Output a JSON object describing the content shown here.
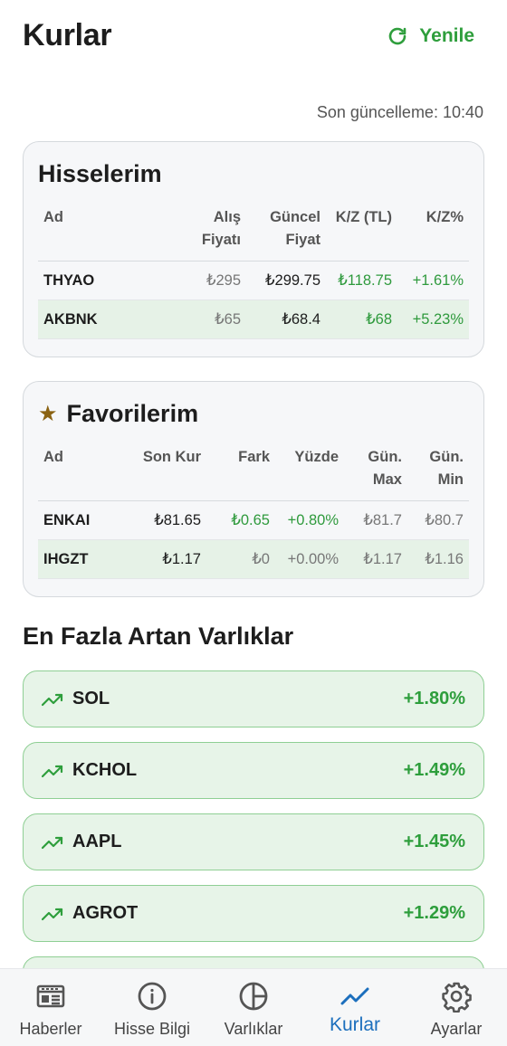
{
  "header": {
    "title": "Kurlar",
    "refresh_label": "Yenile"
  },
  "last_update": "Son güncelleme: 10:40",
  "holdings": {
    "title": "Hisselerim",
    "columns": [
      {
        "line1": "Ad",
        "line2": ""
      },
      {
        "line1": "Alış",
        "line2": "Fiyatı"
      },
      {
        "line1": "Güncel",
        "line2": "Fiyat"
      },
      {
        "line1": "K/Z (TL)",
        "line2": ""
      },
      {
        "line1": "K/Z%",
        "line2": ""
      }
    ],
    "rows": [
      {
        "symbol": "THYAO",
        "buy": "₺295",
        "current": "₺299.75",
        "pl": "₺118.75",
        "pl_pct": "+1.61%"
      },
      {
        "symbol": "AKBNK",
        "buy": "₺65",
        "current": "₺68.4",
        "pl": "₺68",
        "pl_pct": "+5.23%"
      }
    ]
  },
  "favorites": {
    "title": "Favorilerim",
    "columns": [
      {
        "line1": "Ad",
        "line2": ""
      },
      {
        "line1": "Son Kur",
        "line2": ""
      },
      {
        "line1": "Fark",
        "line2": ""
      },
      {
        "line1": "Yüzde",
        "line2": ""
      },
      {
        "line1": "Gün.",
        "line2": "Max"
      },
      {
        "line1": "Gün.",
        "line2": "Min"
      }
    ],
    "rows": [
      {
        "symbol": "ENKAI",
        "last": "₺81.65",
        "diff": "₺0.65",
        "pct": "+0.80%",
        "max": "₺81.7",
        "min": "₺80.7"
      },
      {
        "symbol": "IHGZT",
        "last": "₺1.17",
        "diff": "₺0",
        "pct": "+0.00%",
        "max": "₺1.17",
        "min": "₺1.16"
      }
    ]
  },
  "top_gainers": {
    "title": "En Fazla Artan Varlıklar",
    "items": [
      {
        "symbol": "SOL",
        "change": "+1.80%"
      },
      {
        "symbol": "KCHOL",
        "change": "+1.49%"
      },
      {
        "symbol": "AAPL",
        "change": "+1.45%"
      },
      {
        "symbol": "AGROT",
        "change": "+1.29%"
      },
      {
        "symbol": "",
        "change": ""
      }
    ]
  },
  "nav": {
    "items": [
      {
        "label": "Haberler",
        "icon": "newspaper-icon"
      },
      {
        "label": "Hisse Bilgi",
        "icon": "info-icon"
      },
      {
        "label": "Varlıklar",
        "icon": "pie-chart-icon"
      },
      {
        "label": "Kurlar",
        "icon": "trending-up-icon"
      },
      {
        "label": "Ayarlar",
        "icon": "gear-icon"
      }
    ]
  },
  "colors": {
    "accent_green": "#2e9e3c",
    "active_nav_blue": "#1c6fbd",
    "star_brown": "#8a6212"
  }
}
